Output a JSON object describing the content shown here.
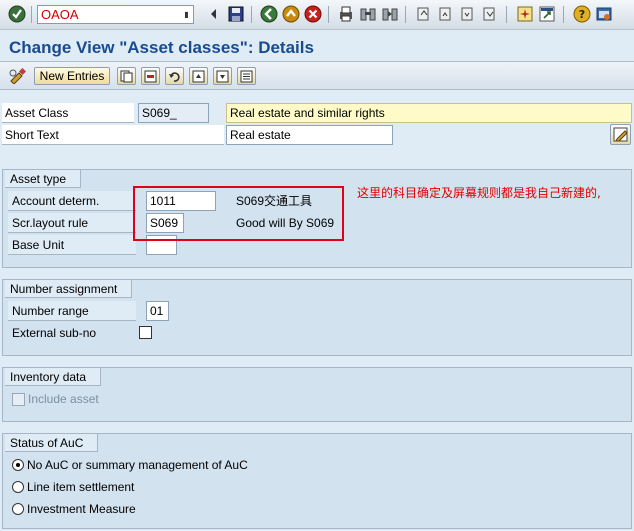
{
  "command_field": {
    "value": "OAOA"
  },
  "title": "Change View \"Asset classes\": Details",
  "app_toolbar": {
    "new_entries_label": "New Entries"
  },
  "header_fields": {
    "asset_class_label": "Asset Class",
    "asset_class_value": "S069_",
    "asset_class_desc": "Real estate and similar rights",
    "short_text_label": "Short Text",
    "short_text_value": "Real estate"
  },
  "asset_type": {
    "title": "Asset type",
    "account_determ_label": "Account determ.",
    "account_determ_value": "1011",
    "account_determ_desc": "S069交通工具",
    "scr_layout_label": "Scr.layout rule",
    "scr_layout_value": "S069",
    "scr_layout_desc": "Good will By S069",
    "base_unit_label": "Base Unit",
    "base_unit_value": ""
  },
  "annotation": {
    "text": "这里的科目确定及屏幕规则都是我自己新建的,",
    "color": "#e00000"
  },
  "number_assignment": {
    "title": "Number assignment",
    "number_range_label": "Number range",
    "number_range_value": "01",
    "external_subno_label": "External sub-no",
    "external_subno_checked": false
  },
  "inventory_data": {
    "title": "Inventory data",
    "include_asset_label": "Include asset",
    "include_asset_checked": false
  },
  "status_auc": {
    "title": "Status of AuC",
    "options": [
      {
        "label": "No AuC or summary management of AuC",
        "selected": true
      },
      {
        "label": "Line item settlement",
        "selected": false
      },
      {
        "label": "Investment Measure",
        "selected": false
      }
    ]
  },
  "colors": {
    "title_blue": "#1a4b8e",
    "background": "#dfebf5",
    "group_background": "#d3e2ef",
    "highlight_red": "#e0001a",
    "desc_yellow": "#fffbc9"
  }
}
